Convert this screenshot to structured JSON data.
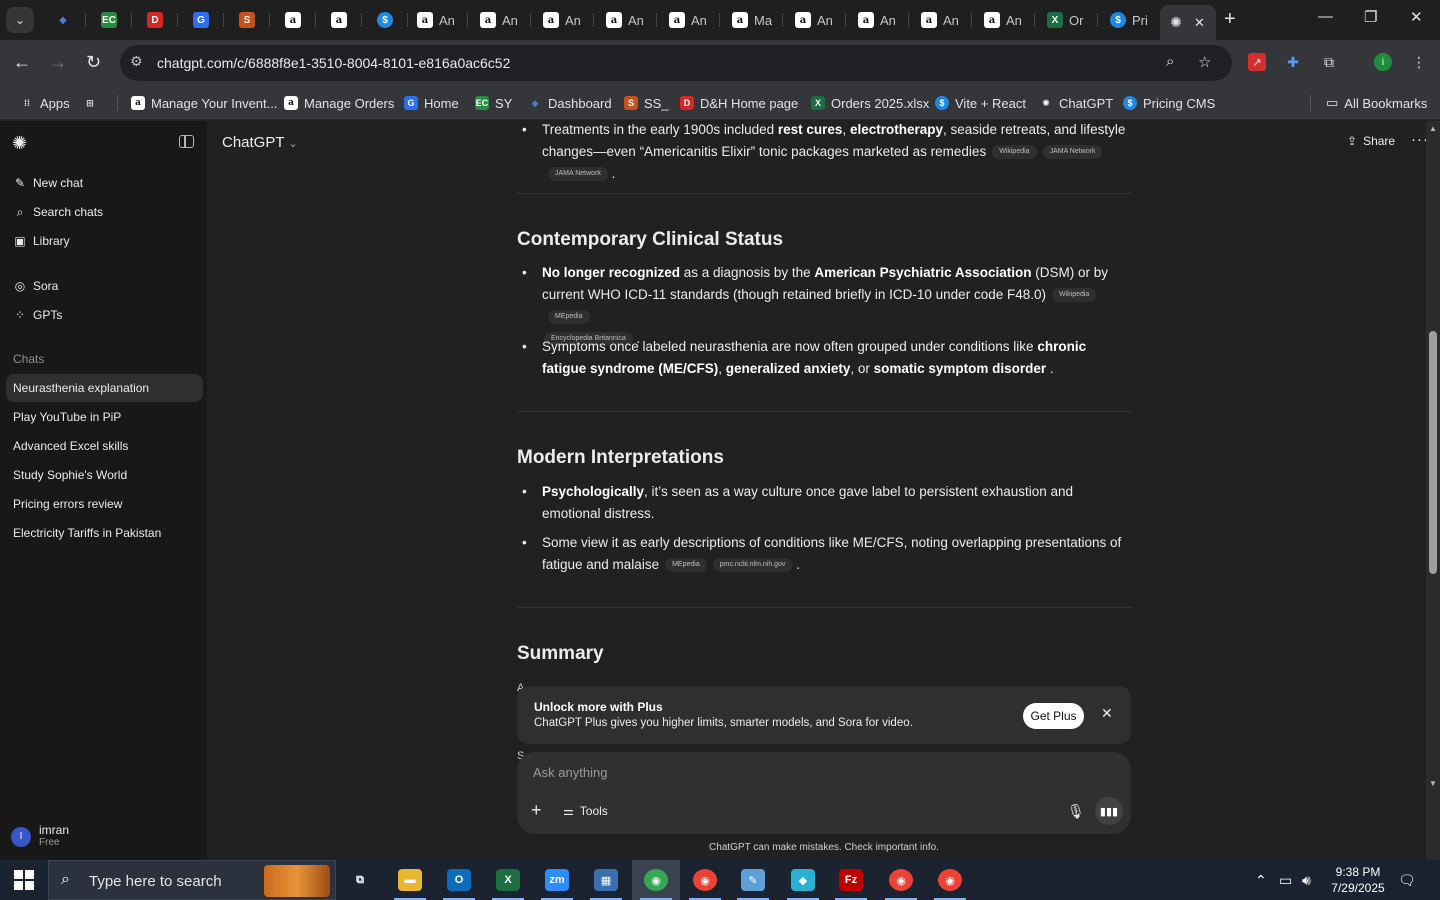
{
  "browser": {
    "tabs_pinned": [
      {
        "icon": "vite-icon",
        "glyph": "◆",
        "color": "#4b7bd8"
      },
      {
        "icon": "ec-icon",
        "glyph": "EC",
        "color": "#2a8c3d"
      },
      {
        "icon": "dh-icon",
        "glyph": "D",
        "color": "#d62626"
      },
      {
        "icon": "google-sites-icon",
        "glyph": "G",
        "color": "#2d6ef0"
      },
      {
        "icon": "ss-icon",
        "glyph": "S",
        "color": "#c5531f"
      },
      {
        "icon": "amazon-icon",
        "glyph": "a",
        "color": "#ffffff"
      },
      {
        "icon": "amazon-icon",
        "glyph": "a",
        "color": "#ffffff"
      },
      {
        "icon": "pricing-icon",
        "glyph": "$",
        "color": "#1e88e5"
      }
    ],
    "tabs": [
      {
        "label": "An",
        "icon": "amazon-icon"
      },
      {
        "label": "An",
        "icon": "amazon-icon"
      },
      {
        "label": "An",
        "icon": "amazon-icon"
      },
      {
        "label": "An",
        "icon": "amazon-icon"
      },
      {
        "label": "An",
        "icon": "amazon-icon"
      },
      {
        "label": "Ma",
        "icon": "amazon-icon"
      },
      {
        "label": "An",
        "icon": "amazon-icon"
      },
      {
        "label": "An",
        "icon": "amazon-icon"
      },
      {
        "label": "An",
        "icon": "amazon-icon"
      },
      {
        "label": "An",
        "icon": "amazon-icon"
      },
      {
        "label": "Or",
        "icon": "excel-icon"
      },
      {
        "label": "Pri",
        "icon": "pricing-icon"
      }
    ],
    "active_tab_icon": "chatgpt-icon",
    "url": "chatgpt.com/c/6888f8e1-3510-8004-8101-e816a0ac6c52",
    "bookmarks": [
      {
        "label": "Apps",
        "icon": "apps-grid-icon"
      },
      {
        "label": "",
        "icon": "grid-icon"
      },
      {
        "label": "Manage Your Invent...",
        "icon": "amazon-icon"
      },
      {
        "label": "Manage Orders",
        "icon": "amazon-icon"
      },
      {
        "label": "Home",
        "icon": "google-sites-icon"
      },
      {
        "label": "SY",
        "icon": "ec-icon"
      },
      {
        "label": "Dashboard",
        "icon": "vite-icon"
      },
      {
        "label": "SS_",
        "icon": "ss-icon"
      },
      {
        "label": "D&H Home page",
        "icon": "dh-icon"
      },
      {
        "label": "Orders 2025.xlsx",
        "icon": "excel-icon"
      },
      {
        "label": "Vite + React",
        "icon": "pricing-icon"
      },
      {
        "label": "ChatGPT",
        "icon": "chatgpt-icon"
      },
      {
        "label": "Pricing CMS",
        "icon": "pricing-icon"
      }
    ],
    "all_bookmarks_label": "All Bookmarks"
  },
  "sidebar": {
    "nav": [
      {
        "label": "New chat",
        "icon": "edit-icon"
      },
      {
        "label": "Search chats",
        "icon": "search-icon"
      },
      {
        "label": "Library",
        "icon": "library-icon"
      },
      {
        "label": "Sora",
        "icon": "sora-icon"
      },
      {
        "label": "GPTs",
        "icon": "gpts-icon"
      }
    ],
    "chats_heading": "Chats",
    "chats": [
      "Neurasthenia explanation",
      "Play YouTube in PiP",
      "Advanced Excel skills",
      "Study Sophie's World",
      "Pricing errors review",
      "Electricity Tariffs in Pakistan"
    ],
    "active_chat_index": 0,
    "user": {
      "initial": "I",
      "name": "imran",
      "plan": "Free"
    }
  },
  "header": {
    "model": "ChatGPT",
    "share_label": "Share",
    "more_label": "···"
  },
  "content": {
    "treatments_bullet": {
      "t1": "Treatments in the early 1900s included ",
      "b1": "rest cures",
      "t2": ", ",
      "b2": "electrotherapy",
      "t3": ", seaside retreats, and lifestyle changes—even “Americanitis Elixir” tonic packages marketed as remedies",
      "cites": [
        "Wikipedia",
        "JAMA Network",
        "JAMA Network"
      ],
      "end": "."
    },
    "section1": {
      "heading": "Contemporary Clinical Status",
      "bullet1": {
        "b1": "No longer recognized",
        "t1": " as a diagnosis by the ",
        "b2": "American Psychiatric Association",
        "t2": " (DSM) or by current WHO ICD-11 standards (though retained briefly in ICD-10 under code F48.0)",
        "cites": [
          "Wikipedia",
          "MEpedia",
          "Encyclopedia Britannica"
        ],
        "end": "."
      },
      "bullet2": {
        "t1": "Symptoms once labeled neurasthenia are now often grouped under conditions like ",
        "b1": "chronic fatigue syndrome (ME/CFS)",
        "t2": ", ",
        "b2": "generalized anxiety",
        "t3": ", or ",
        "b3": "somatic symptom disorder",
        "end": " ."
      }
    },
    "section2": {
      "heading": "Modern Interpretations",
      "bullet1": {
        "b1": "Psychologically",
        "t1": ", it’s seen as a way culture once gave label to persistent exhaustion and emotional distress."
      },
      "bullet2": {
        "t1": "Some view it as early descriptions of conditions like ME/CFS, noting overlapping presentations of fatigue and malaise",
        "cites": [
          "MEpedia",
          "pmc.ncbi.nlm.nih.gov"
        ],
        "end": "."
      }
    },
    "section3": {
      "heading": "Summary",
      "partial_a": "A",
      "partial_s": "S"
    }
  },
  "upsell": {
    "title": "Unlock more with Plus",
    "body": "ChatGPT Plus gives you higher limits, smarter models, and Sora for video.",
    "cta": "Get Plus"
  },
  "composer": {
    "placeholder": "Ask anything",
    "tools_label": "Tools"
  },
  "disclaimer": "ChatGPT can make mistakes. Check important info.",
  "taskbar": {
    "search_placeholder": "Type here to search",
    "apps": [
      {
        "name": "task-view",
        "glyph": "⧉",
        "color": "#1b2230"
      },
      {
        "name": "file-explorer",
        "glyph": "▬",
        "color": "#e8b730"
      },
      {
        "name": "outlook",
        "glyph": "O",
        "color": "#0f6cbd"
      },
      {
        "name": "excel",
        "glyph": "X",
        "color": "#1d6f42"
      },
      {
        "name": "zoom",
        "glyph": "zm",
        "color": "#2d8cff"
      },
      {
        "name": "calculator",
        "glyph": "▦",
        "color": "#3a6fb0"
      },
      {
        "name": "chrome",
        "glyph": "◉",
        "color": "#34a853"
      },
      {
        "name": "chrome",
        "glyph": "◉",
        "color": "#ea4335"
      },
      {
        "name": "notepad",
        "glyph": "✎",
        "color": "#5fa0d8"
      },
      {
        "name": "vscode",
        "glyph": "◆",
        "color": "#2ab0d0"
      },
      {
        "name": "filezilla",
        "glyph": "Fz",
        "color": "#bf0000"
      },
      {
        "name": "chrome-profile",
        "glyph": "◉",
        "color": "#ea4335"
      },
      {
        "name": "chrome-profile",
        "glyph": "◉",
        "color": "#ea4335"
      }
    ],
    "time": "9:38 PM",
    "date": "7/29/2025"
  }
}
